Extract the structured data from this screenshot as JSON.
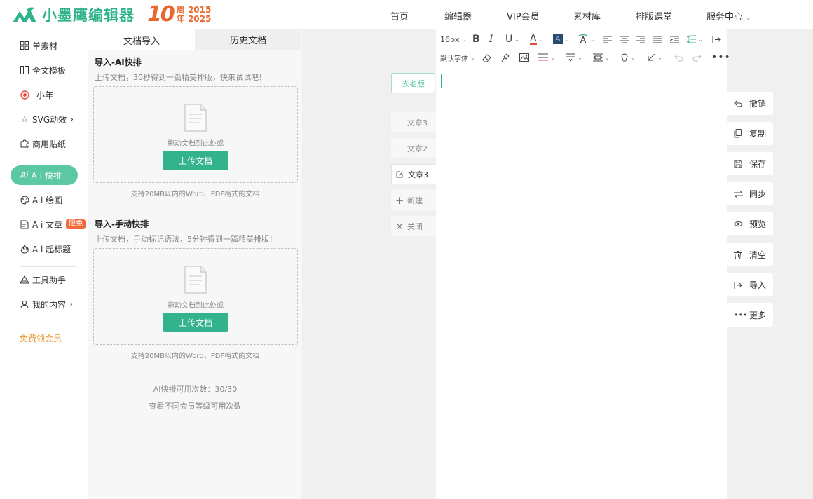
{
  "header": {
    "logo_text": "小墨鹰编辑器",
    "anniv_number": "10",
    "anniv_zhou": "周",
    "anniv_year_start": "2015",
    "anniv_nian": "年",
    "anniv_year_end": "2025",
    "nav": [
      "首页",
      "编辑器",
      "VIP会员",
      "素材库",
      "排版课堂",
      "服务中心"
    ]
  },
  "sidebar": {
    "items": [
      "单素材",
      "全文模板",
      "小年",
      "SVG动效",
      "商用贴纸",
      "A i 快排",
      "A i 绘画",
      "A i 文章",
      "A i 起标题",
      "工具助手",
      "我的内容"
    ],
    "badge": "限免",
    "vip": "免费领会员"
  },
  "panel": {
    "tabs": [
      "文档导入",
      "历史文档"
    ],
    "ai_title": "导入-AI快排",
    "ai_desc": "上传文档，30秒得到一篇精美排版，快来试试吧！",
    "drop_text": "拖动文档到此处或",
    "upload_label": "上传文档",
    "support_note": "支持20MB以内的Word、PDF格式的文档",
    "manual_title": "导入-手动快排",
    "manual_desc": "上传文档，手动标记语法，5分钟得到一篇精美排版！",
    "quota_label": "AI快排可用次数：",
    "quota_value": "30/30",
    "quota_link": "查看不同会员等级可用次数"
  },
  "doc_tabs": {
    "old_version": "去老版",
    "tabs": [
      "文章3",
      "文章2",
      "文章3"
    ],
    "new_label": "新建",
    "close_label": "关闭"
  },
  "editor": {
    "font_size": "16px",
    "font_family": "默认字体"
  },
  "actions": [
    "撤销",
    "复制",
    "保存",
    "同步",
    "预览",
    "清空",
    "导入",
    "更多"
  ],
  "colors": {
    "brand": "#2fb38a",
    "active_pill": "#5cc7a4",
    "anniversary": "#e8672f",
    "badge": "#f36a3a",
    "vip": "#e8942f"
  }
}
